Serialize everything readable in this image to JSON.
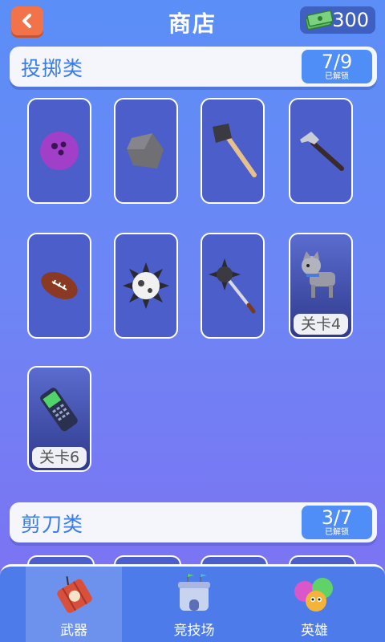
{
  "header": {
    "title": "商店",
    "money": "300"
  },
  "sections": [
    {
      "title": "投掷类",
      "count": "7/9",
      "sub": "已解锁"
    },
    {
      "title": "剪刀类",
      "count": "3/7",
      "sub": "已解锁"
    }
  ],
  "items": {
    "bowling_ball": {
      "icon": "bowling-ball-icon"
    },
    "rock": {
      "icon": "rock-icon"
    },
    "axe": {
      "icon": "axe-icon"
    },
    "hammer": {
      "icon": "hammer-icon"
    },
    "football": {
      "icon": "football-icon"
    },
    "spiked_ball": {
      "icon": "spiked-ball-icon"
    },
    "mace": {
      "icon": "mace-icon"
    },
    "dog": {
      "icon": "dog-icon",
      "level": "关卡4"
    },
    "phone": {
      "icon": "phone-icon",
      "level": "关卡6"
    }
  },
  "nav": [
    {
      "label": "武器",
      "icon": "dynamite-icon",
      "active": true
    },
    {
      "label": "竞技场",
      "icon": "arena-icon",
      "active": false
    },
    {
      "label": "英雄",
      "icon": "heroes-icon",
      "active": false
    }
  ],
  "colors": {
    "accent": "#3a7be6",
    "back_button": "#f2734a",
    "card": "#4b5ec9"
  }
}
